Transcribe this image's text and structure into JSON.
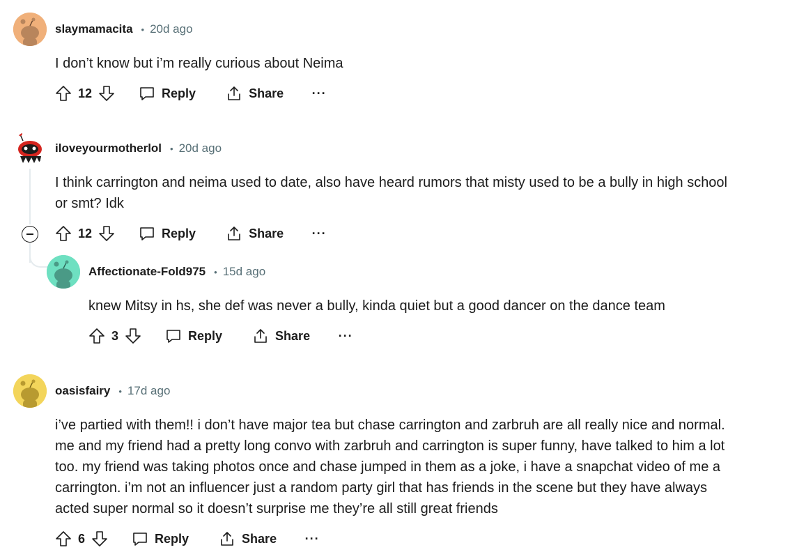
{
  "comments": [
    {
      "username": "slaymamacita",
      "dot": "•",
      "time": "20d ago",
      "avatar_color": "#f0b07a",
      "lines": [
        "I don’t know but i’m really curious about Neima"
      ],
      "votes": "12",
      "reply_label": "Reply",
      "share_label": "Share",
      "more_label": "···"
    },
    {
      "username": "iloveyourmotherlol",
      "dot": "•",
      "time": "20d ago",
      "avatar_color": "#d4251f",
      "lines": [
        "I think carrington and neima used to date, also have heard rumors that misty used to be a bully in high school",
        "or smt? Idk"
      ],
      "votes": "12",
      "reply_label": "Reply",
      "share_label": "Share",
      "more_label": "···"
    },
    {
      "username": "Affectionate-Fold975",
      "dot": "•",
      "time": "15d ago",
      "avatar_color": "#6ee0c1",
      "lines": [
        "knew Mitsy in hs, she def was never a bully, kinda quiet but a good dancer on the dance team"
      ],
      "votes": "3",
      "reply_label": "Reply",
      "share_label": "Share",
      "more_label": "···"
    },
    {
      "username": "oasisfairy",
      "dot": "•",
      "time": "17d ago",
      "avatar_color": "#f3d55b",
      "lines": [
        "i’ve partied with them!! i don’t have major tea but chase carrington and zarbruh are all really nice and normal.",
        "me and my friend had a pretty long convo with zarbruh and carrington is super funny, have talked to him a lot",
        "too. my friend was taking photos once and chase jumped in them as a joke, i have a snapchat video of me a",
        "carrington. i’m not an influencer just a random party girl that has friends in the scene but they have always",
        "acted super normal so it doesn’t surprise me they’re all still great friends"
      ],
      "votes": "6",
      "reply_label": "Reply",
      "share_label": "Share",
      "more_label": "···"
    }
  ],
  "colors": {
    "text": "#1c1c1c",
    "meta": "#576f76",
    "thread_line": "#e5ebee"
  },
  "icons": {
    "upvote": "upvote-arrow-icon",
    "downvote": "downvote-arrow-icon",
    "reply": "speech-bubble-icon",
    "share": "share-upload-icon",
    "more": "more-dots-icon",
    "collapse": "collapse-minus-icon"
  }
}
